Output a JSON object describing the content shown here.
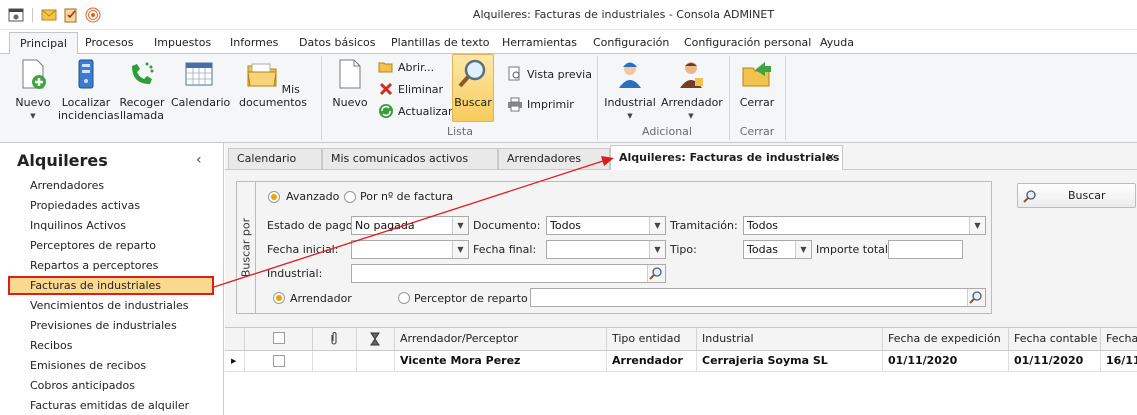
{
  "window": {
    "title": "Alquileres: Facturas de industriales - Consola ADMINET"
  },
  "quick_access": [
    "app-icon",
    "mail-icon",
    "clipboard-icon",
    "broadcast-icon"
  ],
  "ribbon_tabs": [
    "Principal",
    "Procesos",
    "Impuestos",
    "Informes",
    "Datos básicos",
    "Plantillas de texto",
    "Herramientas",
    "Configuración",
    "Configuración personal",
    "Ayuda"
  ],
  "ribbon": {
    "nuevo": "Nuevo",
    "localizar": [
      "Localizar",
      "incidencias"
    ],
    "recoger": [
      "Recoger",
      "llamada"
    ],
    "calendario": "Calendario",
    "mis_documentos": "Mis documentos",
    "nuevo2": "Nuevo",
    "abrir": "Abrir...",
    "eliminar": "Eliminar",
    "actualizar": "Actualizar",
    "buscar": "Buscar",
    "vista_previa": "Vista previa",
    "imprimir": "Imprimir",
    "industrial": "Industrial",
    "arrendador": "Arrendador",
    "cerrar": "Cerrar",
    "group_lista": "Lista",
    "group_adicional": "Adicional",
    "group_cerrar": "Cerrar"
  },
  "left_panel": {
    "title": "Alquileres",
    "collapse": "‹",
    "items": [
      "Arrendadores",
      "Propiedades activas",
      "Inquilinos Activos",
      "Perceptores de reparto",
      "Repartos a perceptores",
      "Facturas de industriales",
      "Vencimientos de industriales",
      "Previsiones de industriales",
      "Recibos",
      "Emisiones de recibos",
      "Cobros anticipados",
      "Facturas emitidas de alquiler"
    ],
    "selected_index": 5
  },
  "doc_tabs": [
    "Calendario",
    "Mis comunicados activos",
    "Arrendadores"
  ],
  "active_tab": {
    "label": "Alquileres: Facturas de industriales",
    "close": "✕"
  },
  "filter": {
    "buscar_por": "Buscar por",
    "mode_avanzado": "Avanzado",
    "mode_factura": "Por nº de factura",
    "estado_label": "Estado de pago:",
    "estado_value": "No pagada",
    "documento_label": "Documento:",
    "documento_value": "Todos",
    "tramitacion_label": "Tramitación:",
    "tramitacion_value": "Todos",
    "fecha_inicial_label": "Fecha inicial:",
    "fecha_final_label": "Fecha final:",
    "tipo_label": "Tipo:",
    "tipo_value": "Todas",
    "importe_label": "Importe total:",
    "industrial_label": "Industrial:",
    "radio_arrendador": "Arrendador",
    "radio_perceptor": "Perceptor de reparto",
    "search_button": "Buscar"
  },
  "grid": {
    "headers": [
      "Arrendador/Perceptor",
      "Tipo entidad",
      "Industrial",
      "Fecha de expedición",
      "Fecha contable",
      "Fecha"
    ],
    "rows": [
      {
        "arrendador": "Vicente Mora Perez",
        "tipo": "Arrendador",
        "industrial": "Cerrajeria Soyma SL",
        "expedicion": "01/11/2020",
        "contable": "01/11/2020",
        "fecha": "16/11"
      }
    ]
  },
  "colors": {
    "accent": "#d9201f",
    "selected_bg": "#fbd98e",
    "buscar_bg": "#f8cc5d"
  }
}
